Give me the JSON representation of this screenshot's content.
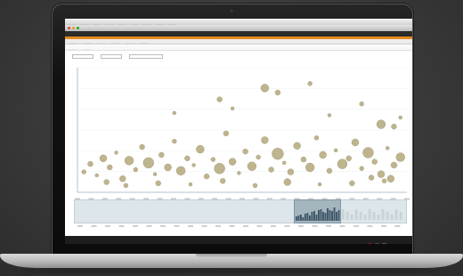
{
  "screen": {
    "menubar": {
      "items": [
        "",
        "",
        "",
        "",
        "",
        "",
        "",
        "",
        ""
      ]
    },
    "window_title": "",
    "navbar_text": "",
    "accent_color": "#e38a1f",
    "bubble_color": "#b3a77a",
    "submenu_items": [
      "",
      "",
      "",
      "",
      "",
      ""
    ],
    "tabs": [
      "",
      ""
    ],
    "controls": {
      "label_1": "",
      "label_2": "",
      "label_3": ""
    }
  },
  "chart_data": {
    "type": "scatter",
    "title": "",
    "xlabel": "",
    "ylabel": "",
    "points": [
      {
        "x": 2,
        "y": 18,
        "r": 2.5
      },
      {
        "x": 4,
        "y": 25,
        "r": 3
      },
      {
        "x": 6,
        "y": 15,
        "r": 2
      },
      {
        "x": 8,
        "y": 30,
        "r": 4
      },
      {
        "x": 10,
        "y": 22,
        "r": 3
      },
      {
        "x": 12,
        "y": 35,
        "r": 2
      },
      {
        "x": 14,
        "y": 12,
        "r": 3.5
      },
      {
        "x": 16,
        "y": 28,
        "r": 5
      },
      {
        "x": 18,
        "y": 20,
        "r": 2.5
      },
      {
        "x": 20,
        "y": 40,
        "r": 3
      },
      {
        "x": 22,
        "y": 26,
        "r": 6
      },
      {
        "x": 24,
        "y": 16,
        "r": 2
      },
      {
        "x": 26,
        "y": 33,
        "r": 3
      },
      {
        "x": 28,
        "y": 22,
        "r": 4
      },
      {
        "x": 30,
        "y": 45,
        "r": 2.5
      },
      {
        "x": 32,
        "y": 19,
        "r": 5
      },
      {
        "x": 34,
        "y": 30,
        "r": 3
      },
      {
        "x": 36,
        "y": 24,
        "r": 2
      },
      {
        "x": 38,
        "y": 38,
        "r": 4.5
      },
      {
        "x": 40,
        "y": 14,
        "r": 3
      },
      {
        "x": 42,
        "y": 29,
        "r": 2.5
      },
      {
        "x": 44,
        "y": 21,
        "r": 6
      },
      {
        "x": 46,
        "y": 52,
        "r": 3
      },
      {
        "x": 48,
        "y": 27,
        "r": 4
      },
      {
        "x": 50,
        "y": 17,
        "r": 2
      },
      {
        "x": 52,
        "y": 36,
        "r": 3
      },
      {
        "x": 54,
        "y": 23,
        "r": 5
      },
      {
        "x": 56,
        "y": 31,
        "r": 2.5
      },
      {
        "x": 58,
        "y": 46,
        "r": 4
      },
      {
        "x": 60,
        "y": 20,
        "r": 3
      },
      {
        "x": 62,
        "y": 34,
        "r": 6.5
      },
      {
        "x": 64,
        "y": 26,
        "r": 2
      },
      {
        "x": 66,
        "y": 18,
        "r": 3.5
      },
      {
        "x": 68,
        "y": 41,
        "r": 4
      },
      {
        "x": 70,
        "y": 29,
        "r": 3
      },
      {
        "x": 72,
        "y": 22,
        "r": 5
      },
      {
        "x": 74,
        "y": 48,
        "r": 2.5
      },
      {
        "x": 76,
        "y": 33,
        "r": 4
      },
      {
        "x": 78,
        "y": 19,
        "r": 3
      },
      {
        "x": 80,
        "y": 37,
        "r": 2
      },
      {
        "x": 82,
        "y": 25,
        "r": 5.5
      },
      {
        "x": 84,
        "y": 30,
        "r": 3
      },
      {
        "x": 86,
        "y": 44,
        "r": 4
      },
      {
        "x": 88,
        "y": 21,
        "r": 2.5
      },
      {
        "x": 90,
        "y": 35,
        "r": 6
      },
      {
        "x": 92,
        "y": 27,
        "r": 3
      },
      {
        "x": 94,
        "y": 16,
        "r": 4
      },
      {
        "x": 96,
        "y": 39,
        "r": 2
      },
      {
        "x": 98,
        "y": 24,
        "r": 3.5
      },
      {
        "x": 100,
        "y": 31,
        "r": 5
      },
      {
        "x": 30,
        "y": 70,
        "r": 2
      },
      {
        "x": 44,
        "y": 82,
        "r": 3
      },
      {
        "x": 48,
        "y": 74,
        "r": 2
      },
      {
        "x": 58,
        "y": 92,
        "r": 4.5
      },
      {
        "x": 62,
        "y": 88,
        "r": 3
      },
      {
        "x": 72,
        "y": 96,
        "r": 2.5
      },
      {
        "x": 78,
        "y": 68,
        "r": 2
      },
      {
        "x": 88,
        "y": 78,
        "r": 2.5
      },
      {
        "x": 94,
        "y": 60,
        "r": 5
      },
      {
        "x": 98,
        "y": 58,
        "r": 3
      },
      {
        "x": 100,
        "y": 66,
        "r": 2
      },
      {
        "x": 9,
        "y": 9,
        "r": 3
      },
      {
        "x": 15,
        "y": 6,
        "r": 2.5
      },
      {
        "x": 25,
        "y": 8,
        "r": 3
      },
      {
        "x": 35,
        "y": 7,
        "r": 2
      },
      {
        "x": 45,
        "y": 10,
        "r": 3
      },
      {
        "x": 55,
        "y": 6,
        "r": 2.5
      },
      {
        "x": 65,
        "y": 9,
        "r": 4
      },
      {
        "x": 75,
        "y": 7,
        "r": 2
      },
      {
        "x": 85,
        "y": 8,
        "r": 3
      },
      {
        "x": 95,
        "y": 10,
        "r": 2.5
      },
      {
        "x": 97,
        "y": 12,
        "r": 4
      },
      {
        "x": 91,
        "y": 13,
        "r": 3
      }
    ],
    "xlim": [
      0,
      102
    ],
    "ylim": [
      0,
      110
    ],
    "grid": true,
    "x_ticks": [
      "",
      "",
      "",
      "",
      "",
      "",
      "",
      "",
      "",
      "",
      "",
      "",
      "",
      "",
      "",
      "",
      "",
      "",
      "",
      "",
      "",
      "",
      "",
      "",
      ""
    ]
  },
  "overview": {
    "selected_range": [
      0.665,
      0.8
    ],
    "bar_color": "#3e5564",
    "bar_values": [
      0.25,
      0.3,
      0.35,
      0.2,
      0.4,
      0.45,
      0.3,
      0.5,
      0.55,
      0.35,
      0.6,
      0.65,
      0.5,
      0.45,
      0.7,
      0.6,
      0.55,
      0.75,
      0.5,
      0.6
    ]
  }
}
